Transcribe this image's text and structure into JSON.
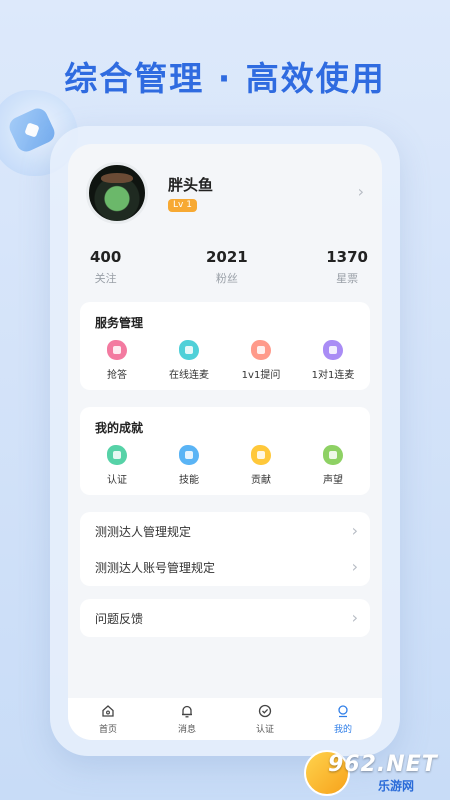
{
  "headline": "综合管理 · 高效使用",
  "colors": {
    "accent": "#2f6be0",
    "level_badge": "#f7a933",
    "active_tab": "#2f7ee8"
  },
  "profile": {
    "name": "胖头鱼",
    "level": "Lv 1"
  },
  "stats": [
    {
      "value": "400",
      "label": "关注"
    },
    {
      "value": "2021",
      "label": "粉丝"
    },
    {
      "value": "1370",
      "label": "星票"
    }
  ],
  "services": {
    "title": "服务管理",
    "items": [
      {
        "label": "抢答",
        "icon": "lightning-icon",
        "color": "#f37aa0"
      },
      {
        "label": "在线连麦",
        "icon": "play-icon",
        "color": "#4fd0d8"
      },
      {
        "label": "1v1提问",
        "icon": "message-icon",
        "color": "#ff9a8a"
      },
      {
        "label": "1对1连麦",
        "icon": "phone-icon",
        "color": "#a98cf5"
      }
    ]
  },
  "achievements": {
    "title": "我的成就",
    "items": [
      {
        "label": "认证",
        "icon": "check-icon",
        "color": "#56d2a7"
      },
      {
        "label": "技能",
        "icon": "skill-icon",
        "color": "#5ab4f5"
      },
      {
        "label": "贡献",
        "icon": "contribution-icon",
        "color": "#ffc83a"
      },
      {
        "label": "声望",
        "icon": "reputation-icon",
        "color": "#8ed164"
      }
    ]
  },
  "rules": [
    "测测达人管理规定",
    "测测达人账号管理规定"
  ],
  "feedback": "问题反馈",
  "tabs": [
    {
      "label": "首页",
      "icon": "home-icon"
    },
    {
      "label": "消息",
      "icon": "bell-icon"
    },
    {
      "label": "认证",
      "icon": "badge-check-icon"
    },
    {
      "label": "我的",
      "icon": "profile-icon",
      "active": true
    }
  ],
  "watermark": {
    "text": "962.NET",
    "sub": "乐游网"
  }
}
